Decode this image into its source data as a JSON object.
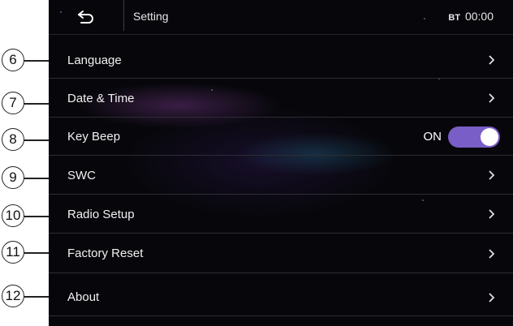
{
  "header": {
    "title": "Setting",
    "bt_label": "BT",
    "clock": "00:00"
  },
  "menu": [
    {
      "label": "Language"
    },
    {
      "label": "Date & Time"
    },
    {
      "label": "Key Beep",
      "toggle": "ON"
    },
    {
      "label": "SWC"
    },
    {
      "label": "Radio Setup"
    },
    {
      "label": "Factory Reset"
    },
    {
      "label": "About"
    }
  ],
  "callouts": [
    "6",
    "7",
    "8",
    "9",
    "10",
    "11",
    "12"
  ],
  "colors": {
    "toggle_on": "#7a5ec7",
    "background": "#07070b"
  }
}
